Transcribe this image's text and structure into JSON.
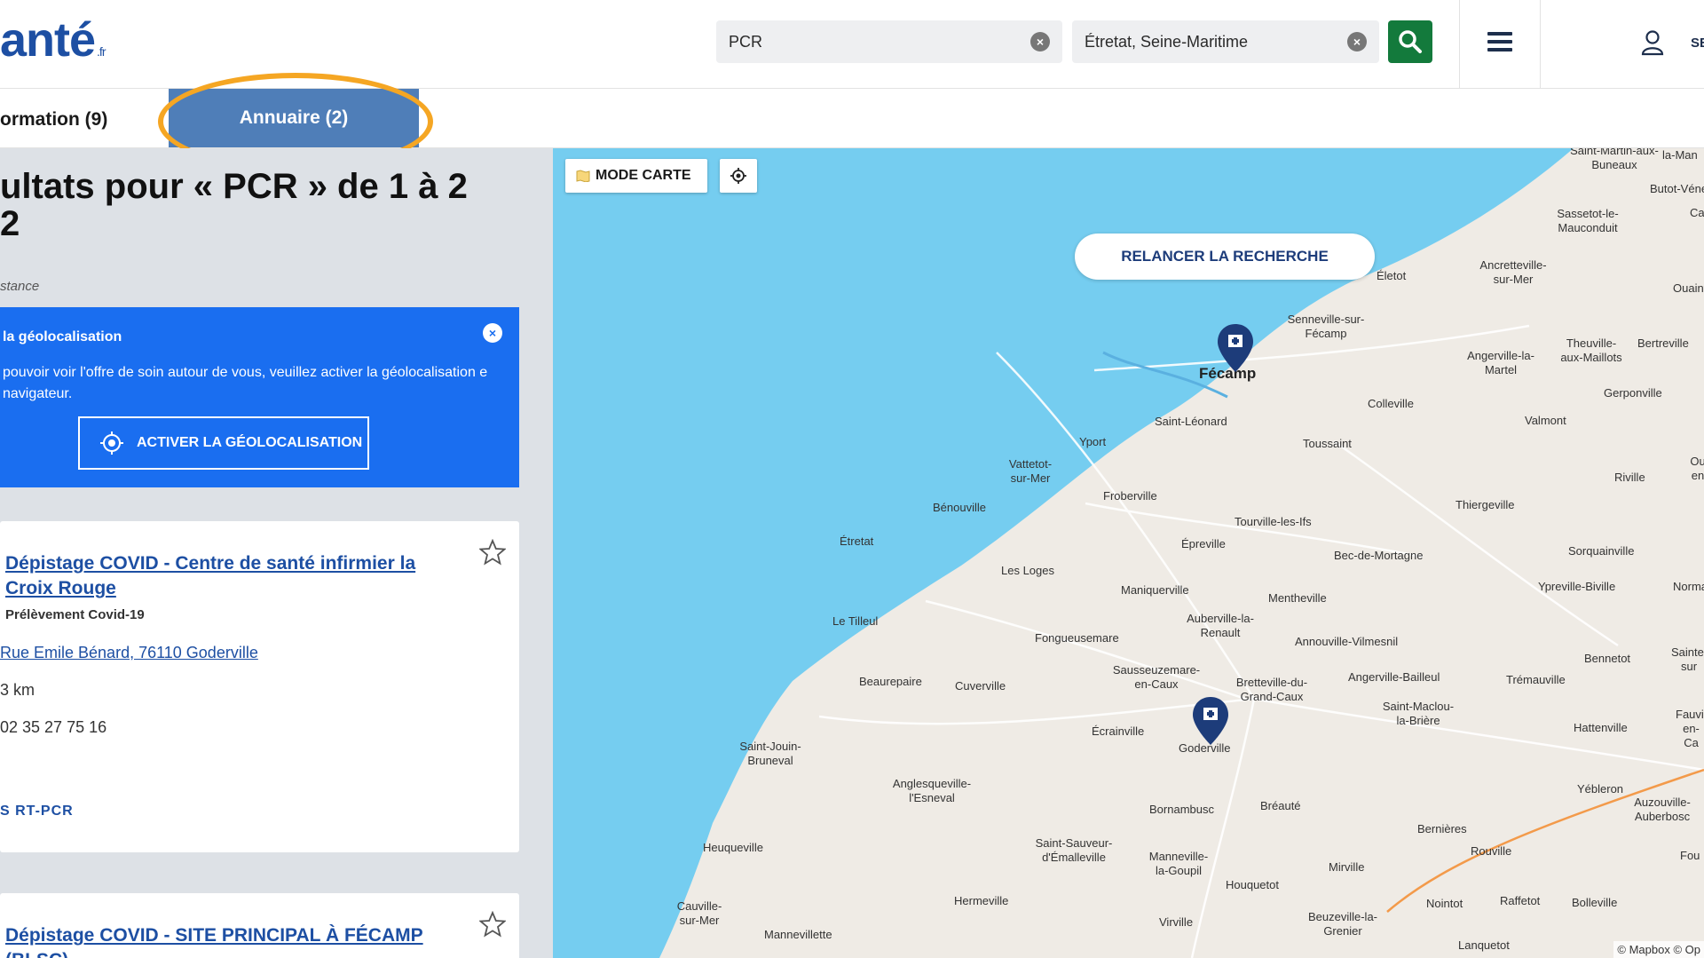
{
  "header": {
    "logo_text": "anté",
    "logo_suffix": ".fr",
    "search_what": "PCR",
    "search_where": "Étretat, Seine-Maritime",
    "user_label": "SE"
  },
  "tabs": {
    "information": "ormation (9)",
    "annuaire": "Annuaire (2)"
  },
  "results": {
    "title": "ultats pour « PCR » de 1 à 2 2",
    "sort_label": "stance"
  },
  "geolocation": {
    "title": "la géolocalisation",
    "text": "pouvoir voir l'offre de soin autour de vous, veuillez activer la géolocalisation e navigateur.",
    "button": "ACTIVER LA GÉOLOCALISATION"
  },
  "cards": [
    {
      "title": "Dépistage COVID - Centre de santé infirmier la Croix Rouge",
      "subtitle": "Prélèvement Covid-19",
      "address": "Rue Emile Bénard, 76110 Goderville",
      "distance": "3 km",
      "phone": "02 35 27 75 16",
      "tag": "S RT-PCR"
    },
    {
      "title": "Dépistage COVID - SITE PRINCIPAL À FÉCAMP (BLSC)"
    }
  ],
  "map": {
    "mode_button": "MODE CARTE",
    "relaunch": "RELANCER LA RECHERCHE",
    "attribution": "© Mapbox © Op",
    "places": [
      "Fécamp",
      "Saint-Léonard",
      "Yport",
      "Vattetot-sur-Mer",
      "Bénouville",
      "Étretat",
      "Froberville",
      "Épreville",
      "Les Loges",
      "Le Tilleul",
      "Maniquerville",
      "Auberville-la-Renault",
      "Fongueusemare",
      "Beaurepaire",
      "Cuverville",
      "Sausseuzemare-en-Caux",
      "Bretteville-du-Grand-Caux",
      "Écrainville",
      "Goderville",
      "Saint-Jouin-Bruneval",
      "Anglesqueville-l'Esneval",
      "Bornambusc",
      "Bréauté",
      "Saint-Sauveur-d'Émalleville",
      "Manneville-la-Goupil",
      "Heuqueville",
      "Hermeville",
      "Houquetot",
      "Virville",
      "Cauville-sur-Mer",
      "Mannevillette",
      "Senneville-sur-Fécamp",
      "Életot",
      "Colleville",
      "Toussaint",
      "Tourville-les-Ifs",
      "Mentheville",
      "Annouville-Vilmesnil",
      "Angerville-Bailleul",
      "Saint-Maclou-la-Brière",
      "Bec-de-Mortagne",
      "Angerville-la-Martel",
      "Valmont",
      "Thiergeville",
      "Sorquainville",
      "Ypreville-Biville",
      "Trémauville",
      "Hattenville",
      "Bennetot",
      "Yébleron",
      "Bernières",
      "Rouville",
      "Mirville",
      "Raffetot",
      "Nointot",
      "Bolleville",
      "Beuzeville-la-Grenier",
      "Lanquetot",
      "Auzouville-Auberbosc",
      "Riville",
      "Gerponville",
      "Theuville-aux-Maillots",
      "Bertreville",
      "Ancretteville-sur-Mer",
      "Sassetot-le-Mauconduit",
      "Saint-Martin-aux-Buneaux",
      "la-Man",
      "Butot-Vénes",
      "Ca",
      "Ouainv",
      "Ou en",
      "Norma",
      "Sainte-sur",
      "Fauvill en-Ca",
      "Fou"
    ]
  },
  "colors": {
    "brand_blue": "#1d4fa3",
    "tab_active": "#4f7eb8",
    "geo_blue": "#1a6ef0",
    "search_green": "#137a3c",
    "highlight": "#f5a623",
    "sea": "#75cdf0",
    "land": "#efebe5"
  }
}
